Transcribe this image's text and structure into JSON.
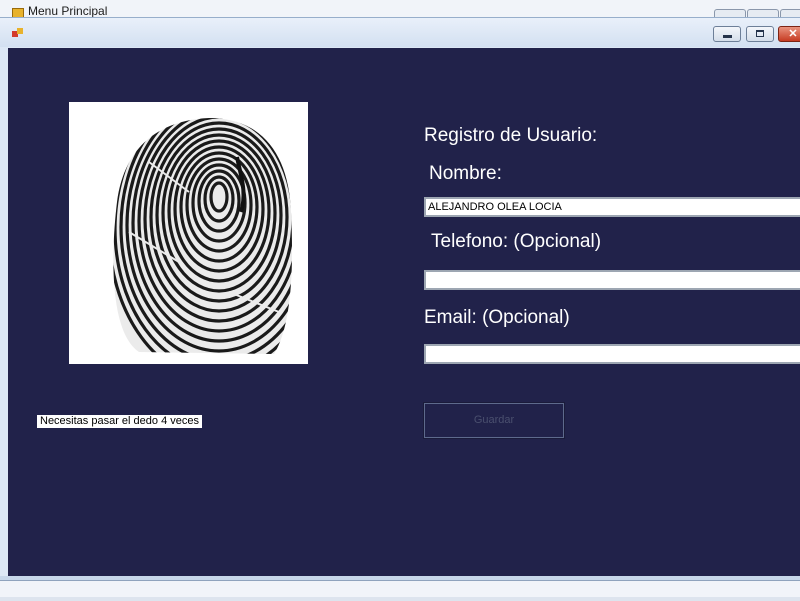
{
  "background_window": {
    "title": "Menu Principal"
  },
  "dialog": {
    "controls": {
      "minimize_glyph": "",
      "maximize_glyph": "",
      "close_glyph": "✕"
    },
    "status_hint": "Necesitas pasar el dedo 4 veces",
    "form": {
      "heading": "Registro de Usuario:",
      "nombre_label": "Nombre:",
      "nombre_value": "ALEJANDRO OLEA LOCIA",
      "telefono_label": "Telefono: (Opcional)",
      "telefono_value": "",
      "email_label": "Email: (Opcional)",
      "email_value": "",
      "save_label": "Guardar"
    }
  },
  "colors": {
    "client_background": "#21224a",
    "label_text": "#ffffff",
    "disabled_text": "#4a4f6e"
  },
  "icons": [
    "app-icon",
    "fingerprint-icon",
    "minimize-icon",
    "maximize-icon",
    "close-icon"
  ]
}
